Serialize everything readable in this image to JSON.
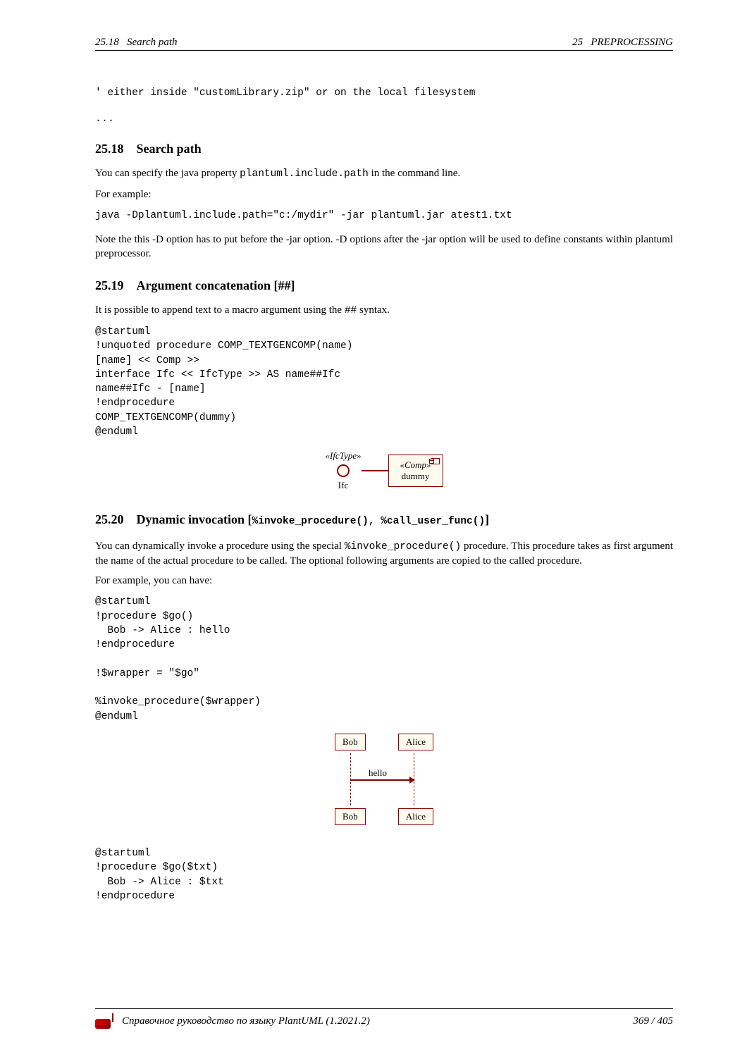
{
  "header": {
    "left_section": "25.18",
    "left_title": "Search path",
    "right_chapter": "25",
    "right_title": "PREPROCESSING"
  },
  "intro_code": "' either inside \"customLibrary.zip\" or on the local filesystem",
  "ellipsis": "...",
  "s1": {
    "num": "25.18",
    "title": "Search path",
    "p1_a": "You can specify the java property ",
    "p1_code": "plantuml.include.path",
    "p1_b": " in the command line.",
    "p2": "For example:",
    "code": "java -Dplantuml.include.path=\"c:/mydir\" -jar plantuml.jar atest1.txt",
    "p3": "Note the this -D option has to put before the -jar option. -D options after the -jar option will be used to define constants within plantuml preprocessor."
  },
  "s2": {
    "num": "25.19",
    "title": "Argument concatenation [##]",
    "p1_a": "It is possible to append text to a macro argument using the ",
    "p1_code": "##",
    "p1_b": " syntax.",
    "code": "@startuml\n!unquoted procedure COMP_TEXTGENCOMP(name)\n[name] << Comp >>\ninterface Ifc << IfcType >> AS name##Ifc\nname##Ifc - [name]\n!endprocedure\nCOMP_TEXTGENCOMP(dummy)\n@enduml",
    "diagram": {
      "ifc_stereo": "«IfcType»",
      "ifc_name": "Ifc",
      "comp_stereo": "«Comp»",
      "comp_name": "dummy"
    }
  },
  "s3": {
    "num": "25.20",
    "title_a": "Dynamic invocation [",
    "title_code": "%invoke_procedure(), %call_user_func()",
    "title_b": "]",
    "p1_a": "You can dynamically invoke a procedure using the special ",
    "p1_code": "%invoke_procedure()",
    "p1_b": " procedure. This procedure takes as first argument the name of the actual procedure to be called. The optional following arguments are copied to the called procedure.",
    "p2": "For example, you can have:",
    "code1": "@startuml\n!procedure $go()\n  Bob -> Alice : hello\n!endprocedure\n\n!$wrapper = \"$go\"\n\n%invoke_procedure($wrapper)\n@enduml",
    "diagram": {
      "bob": "Bob",
      "alice": "Alice",
      "msg": "hello"
    },
    "code2": "@startuml\n!procedure $go($txt)\n  Bob -> Alice : $txt\n!endprocedure"
  },
  "footer": {
    "text": "Справочное руководство по языку PlantUML (1.2021.2)",
    "page": "369 / 405"
  }
}
